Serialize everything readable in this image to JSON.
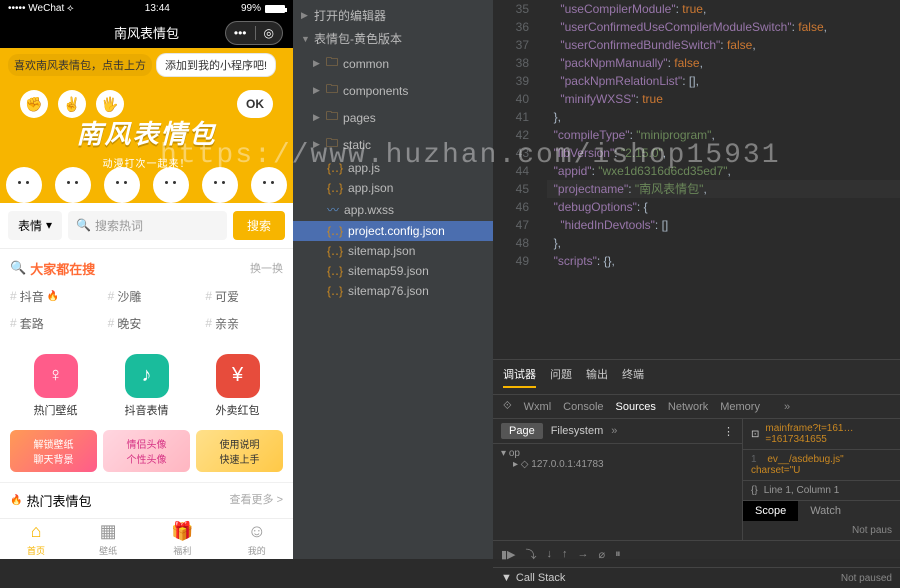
{
  "phone": {
    "statusbar": {
      "carrier": "WeChat",
      "time": "13:44",
      "battery": "99%"
    },
    "navbar": {
      "title": "南风表情包"
    },
    "tip": {
      "left": "喜欢南风表情包，点击上方",
      "right": "添加到我的小程序吧!"
    },
    "hero": {
      "title": "南风表情包",
      "subtitle": "动漫打次一起来！",
      "ok": "OK"
    },
    "search": {
      "category": "表情",
      "placeholder": "搜索热词",
      "button": "搜索"
    },
    "hot": {
      "title": "大家都在搜",
      "refresh": "换一换",
      "tags": [
        "抖音",
        "沙雕",
        "可爱",
        "套路",
        "晚安",
        "亲亲"
      ]
    },
    "tiles": [
      {
        "label": "热门壁纸",
        "color": "t-pink",
        "icon": "♀"
      },
      {
        "label": "抖音表情",
        "color": "t-teal",
        "icon": "♪"
      },
      {
        "label": "外卖红包",
        "color": "t-red",
        "icon": "¥"
      }
    ],
    "banners": [
      {
        "line1": "解锁壁纸",
        "line2": "聊天背景"
      },
      {
        "line1": "情侣头像",
        "line2": "个性头像"
      },
      {
        "line1": "使用说明",
        "line2": "快速上手"
      }
    ],
    "section": {
      "title": "热门表情包",
      "more": "查看更多 >"
    },
    "tabbar": [
      "首页",
      "壁纸",
      "福利",
      "我的"
    ]
  },
  "explorer": {
    "root1": "打开的编辑器",
    "root2": "表情包-黄色版本",
    "folders": [
      "common",
      "components",
      "pages",
      "static"
    ],
    "files": [
      {
        "name": "app.js",
        "icon": "js-ico"
      },
      {
        "name": "app.json",
        "icon": "json-ico"
      },
      {
        "name": "app.wxss",
        "icon": "wxss-ico"
      },
      {
        "name": "project.config.json",
        "icon": "json-ico",
        "selected": true
      },
      {
        "name": "sitemap.json",
        "icon": "json-ico"
      },
      {
        "name": "sitemap59.json",
        "icon": "json-ico"
      },
      {
        "name": "sitemap76.json",
        "icon": "json-ico"
      }
    ]
  },
  "code": {
    "start": 35,
    "lines": [
      "    \"useCompilerModule\": true,",
      "    \"userConfirmedUseCompilerModuleSwitch\": false,",
      "    \"userConfirmedBundleSwitch\": false,",
      "    \"packNpmManually\": false,",
      "    \"packNpmRelationList\": [],",
      "    \"minifyWXSS\": true",
      "  },",
      "  \"compileType\": \"miniprogram\",",
      "  \"libVersion\": \"2.15.0\",",
      "  \"appid\": \"wxe1d6316d6cd35ed7\",",
      "  \"projectname\": \"南风表情包\",",
      "  \"debugOptions\": {",
      "    \"hidedInDevtools\": []",
      "  },",
      "  \"scripts\": {},"
    ]
  },
  "devtools": {
    "tabs1": [
      "调试器",
      "问题",
      "输出",
      "终端"
    ],
    "tabs2": [
      "Wxml",
      "Console",
      "Sources",
      "Network",
      "Memory"
    ],
    "page": "Page",
    "filesystem": "Filesystem",
    "top": "op",
    "addr": "127.0.0.1:41783",
    "mainframe": "mainframe?t=161…=1617341655",
    "srcline": "ev__/asdebug.js\" charset=\"U",
    "lineNum": "1",
    "pos": "Line 1, Column 1",
    "scope": "Scope",
    "watch": "Watch",
    "callstack": "Call Stack",
    "notpaused": "Not paused",
    "notpaus": "Not paus"
  },
  "watermark": "https://www.huzhan.com/ishop15931"
}
